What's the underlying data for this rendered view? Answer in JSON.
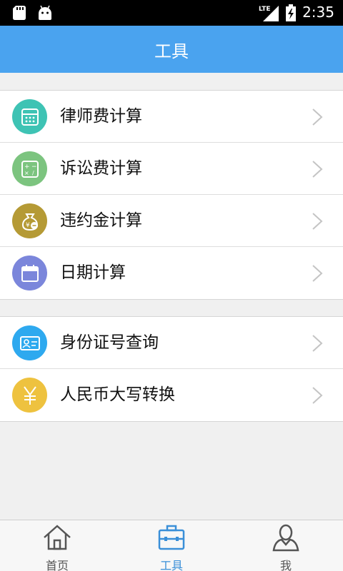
{
  "status_bar": {
    "network": "LTE",
    "time": "2:35"
  },
  "header": {
    "title": "工具"
  },
  "groups": [
    {
      "items": [
        {
          "label": "律师费计算",
          "icon": "calculator-icon",
          "color": "#3ec3b4"
        },
        {
          "label": "诉讼费计算",
          "icon": "math-ops-icon",
          "color": "#7cc47f"
        },
        {
          "label": "违约金计算",
          "icon": "money-bag-icon",
          "color": "#b59a35"
        },
        {
          "label": "日期计算",
          "icon": "calendar-icon",
          "color": "#7b86db"
        }
      ]
    },
    {
      "items": [
        {
          "label": "身份证号查询",
          "icon": "id-card-icon",
          "color": "#2ea9ef"
        },
        {
          "label": "人民币大写转换",
          "icon": "yuan-icon",
          "color": "#eec23f"
        }
      ]
    }
  ],
  "tabbar": {
    "tabs": [
      {
        "label": "首页",
        "icon": "home-icon"
      },
      {
        "label": "工具",
        "icon": "toolbox-icon",
        "active": true
      },
      {
        "label": "我",
        "icon": "user-icon"
      }
    ],
    "active_color": "#3a8fd8"
  }
}
